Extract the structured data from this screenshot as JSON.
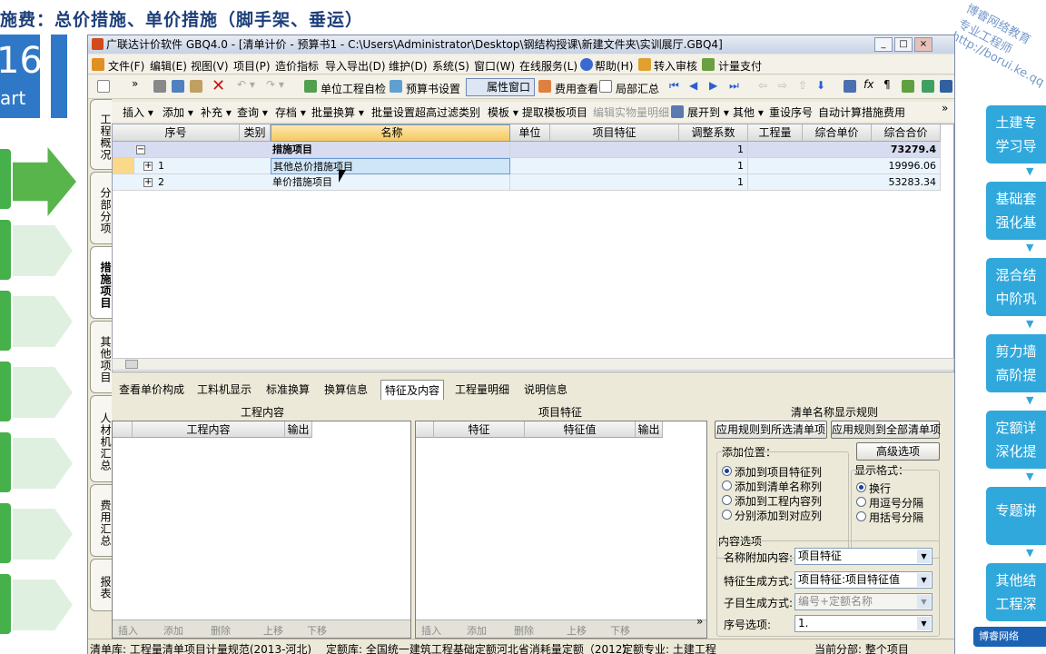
{
  "banner": {
    "title": "施费：总价措施、单价措施（脚手架、垂运）"
  },
  "slide": {
    "number": "16",
    "part": "art",
    "right_items": [
      "土建专\n学习导",
      "基础套\n强化基",
      "混合结\n中阶巩",
      "剪力墙\n高阶提",
      "定额详\n深化提",
      "专题讲",
      "其他结\n工程深"
    ],
    "watermark_lines": [
      "博睿网络教育",
      "专业工程师",
      "http://borui.ke.qq"
    ],
    "logo": "博睿网络"
  },
  "window": {
    "title": "广联达计价软件 GBQ4.0 - [清单计价 - 预算书1 - C:\\Users\\Administrator\\Desktop\\钢结构授课\\新建文件夹\\实训展厅.GBQ4]",
    "btn_min": "_",
    "btn_max": "□",
    "btn_close": "×"
  },
  "menu": [
    "文件(F)",
    "编辑(E)",
    "视图(V)",
    "项目(P)",
    "造价指标",
    "导入导出(D)",
    "维护(D)",
    "系统(S)",
    "窗口(W)",
    "在线服务(L)",
    "帮助(H)",
    "转入审核",
    "计量支付"
  ],
  "toolbar1": {
    "self_check": "单位工程自检",
    "budget_setting": "预算书设置",
    "attr_window": "属性窗口",
    "fee_view": "费用查看",
    "partial_summary": "局部汇总",
    "more": "»"
  },
  "vtabs": [
    "工程概况",
    "分部分项",
    "措施项目",
    "其他项目",
    "人材机汇总",
    "费用汇总",
    "报表"
  ],
  "toolbar2": [
    "插入 ▾",
    "添加 ▾",
    "补充 ▾",
    "查询 ▾",
    "存档 ▾",
    "批量换算 ▾",
    "批量设置超高过滤类别",
    "模板 ▾",
    "提取模板项目",
    "编辑实物量明细",
    "展开到 ▾",
    "其他 ▾",
    "重设序号",
    "自动计算措施费用",
    "»"
  ],
  "grid": {
    "headers": [
      "序号",
      "类别",
      "名称",
      "单位",
      "项目特征",
      "调整系数",
      "工程量",
      "综合单价",
      "综合合价"
    ],
    "rows": [
      {
        "seq": "",
        "cat": "",
        "name": "措施项目",
        "unit": "",
        "feature": "",
        "factor": "1",
        "qty": "",
        "price": "",
        "total": "73279.4",
        "expand": "−"
      },
      {
        "seq": "1",
        "cat": "",
        "name": "其他总价措施项目",
        "unit": "",
        "feature": "",
        "factor": "1",
        "qty": "",
        "price": "",
        "total": "19996.06",
        "expand": "+"
      },
      {
        "seq": "2",
        "cat": "",
        "name": "单价措施项目",
        "unit": "",
        "feature": "",
        "factor": "1",
        "qty": "",
        "price": "",
        "total": "53283.34",
        "expand": "+"
      }
    ]
  },
  "bottom_tabs": [
    "查看单价构成",
    "工料机显示",
    "标准换算",
    "换算信息",
    "特征及内容",
    "工程量明细",
    "说明信息"
  ],
  "panel": {
    "work_title": "工程内容",
    "work_cols": [
      "工程内容",
      "输出"
    ],
    "feat_title": "项目特征",
    "feat_cols": [
      "特征",
      "特征值",
      "输出"
    ],
    "rule_title": "清单名称显示规则",
    "apply_selected": "应用规则到所选清单项",
    "apply_all": "应用规则到全部清单项",
    "add_pos_label": "添加位置：",
    "advanced": "高级选项",
    "add_pos": [
      "添加到项目特征列",
      "添加到清单名称列",
      "添加到工程内容列",
      "分别添加到对应列"
    ],
    "display_label": "显示格式：",
    "display": [
      "换行",
      "用逗号分隔",
      "用括号分隔"
    ],
    "content_label": "内容选项",
    "name_extra_label": "名称附加内容:",
    "name_extra_val": "项目特征",
    "feature_gen_label": "特征生成方式:",
    "feature_gen_val": "项目特征:项目特征值",
    "sub_gen_label": "子目生成方式:",
    "sub_gen_val": "编号+定额名称",
    "seq_label": "序号选项:",
    "seq_val": "1.",
    "mini": [
      "插入",
      "添加",
      "删除",
      "上移",
      "下移"
    ]
  },
  "status": {
    "list_lib": "清单库:  工程量清单项目计量规范(2013-河北)",
    "quota_lib": "定额库:  全国统一建筑工程基础定额河北省消耗量定额（2012）",
    "major": "定额专业:  土建工程",
    "current": "当前分部:  整个项目"
  }
}
